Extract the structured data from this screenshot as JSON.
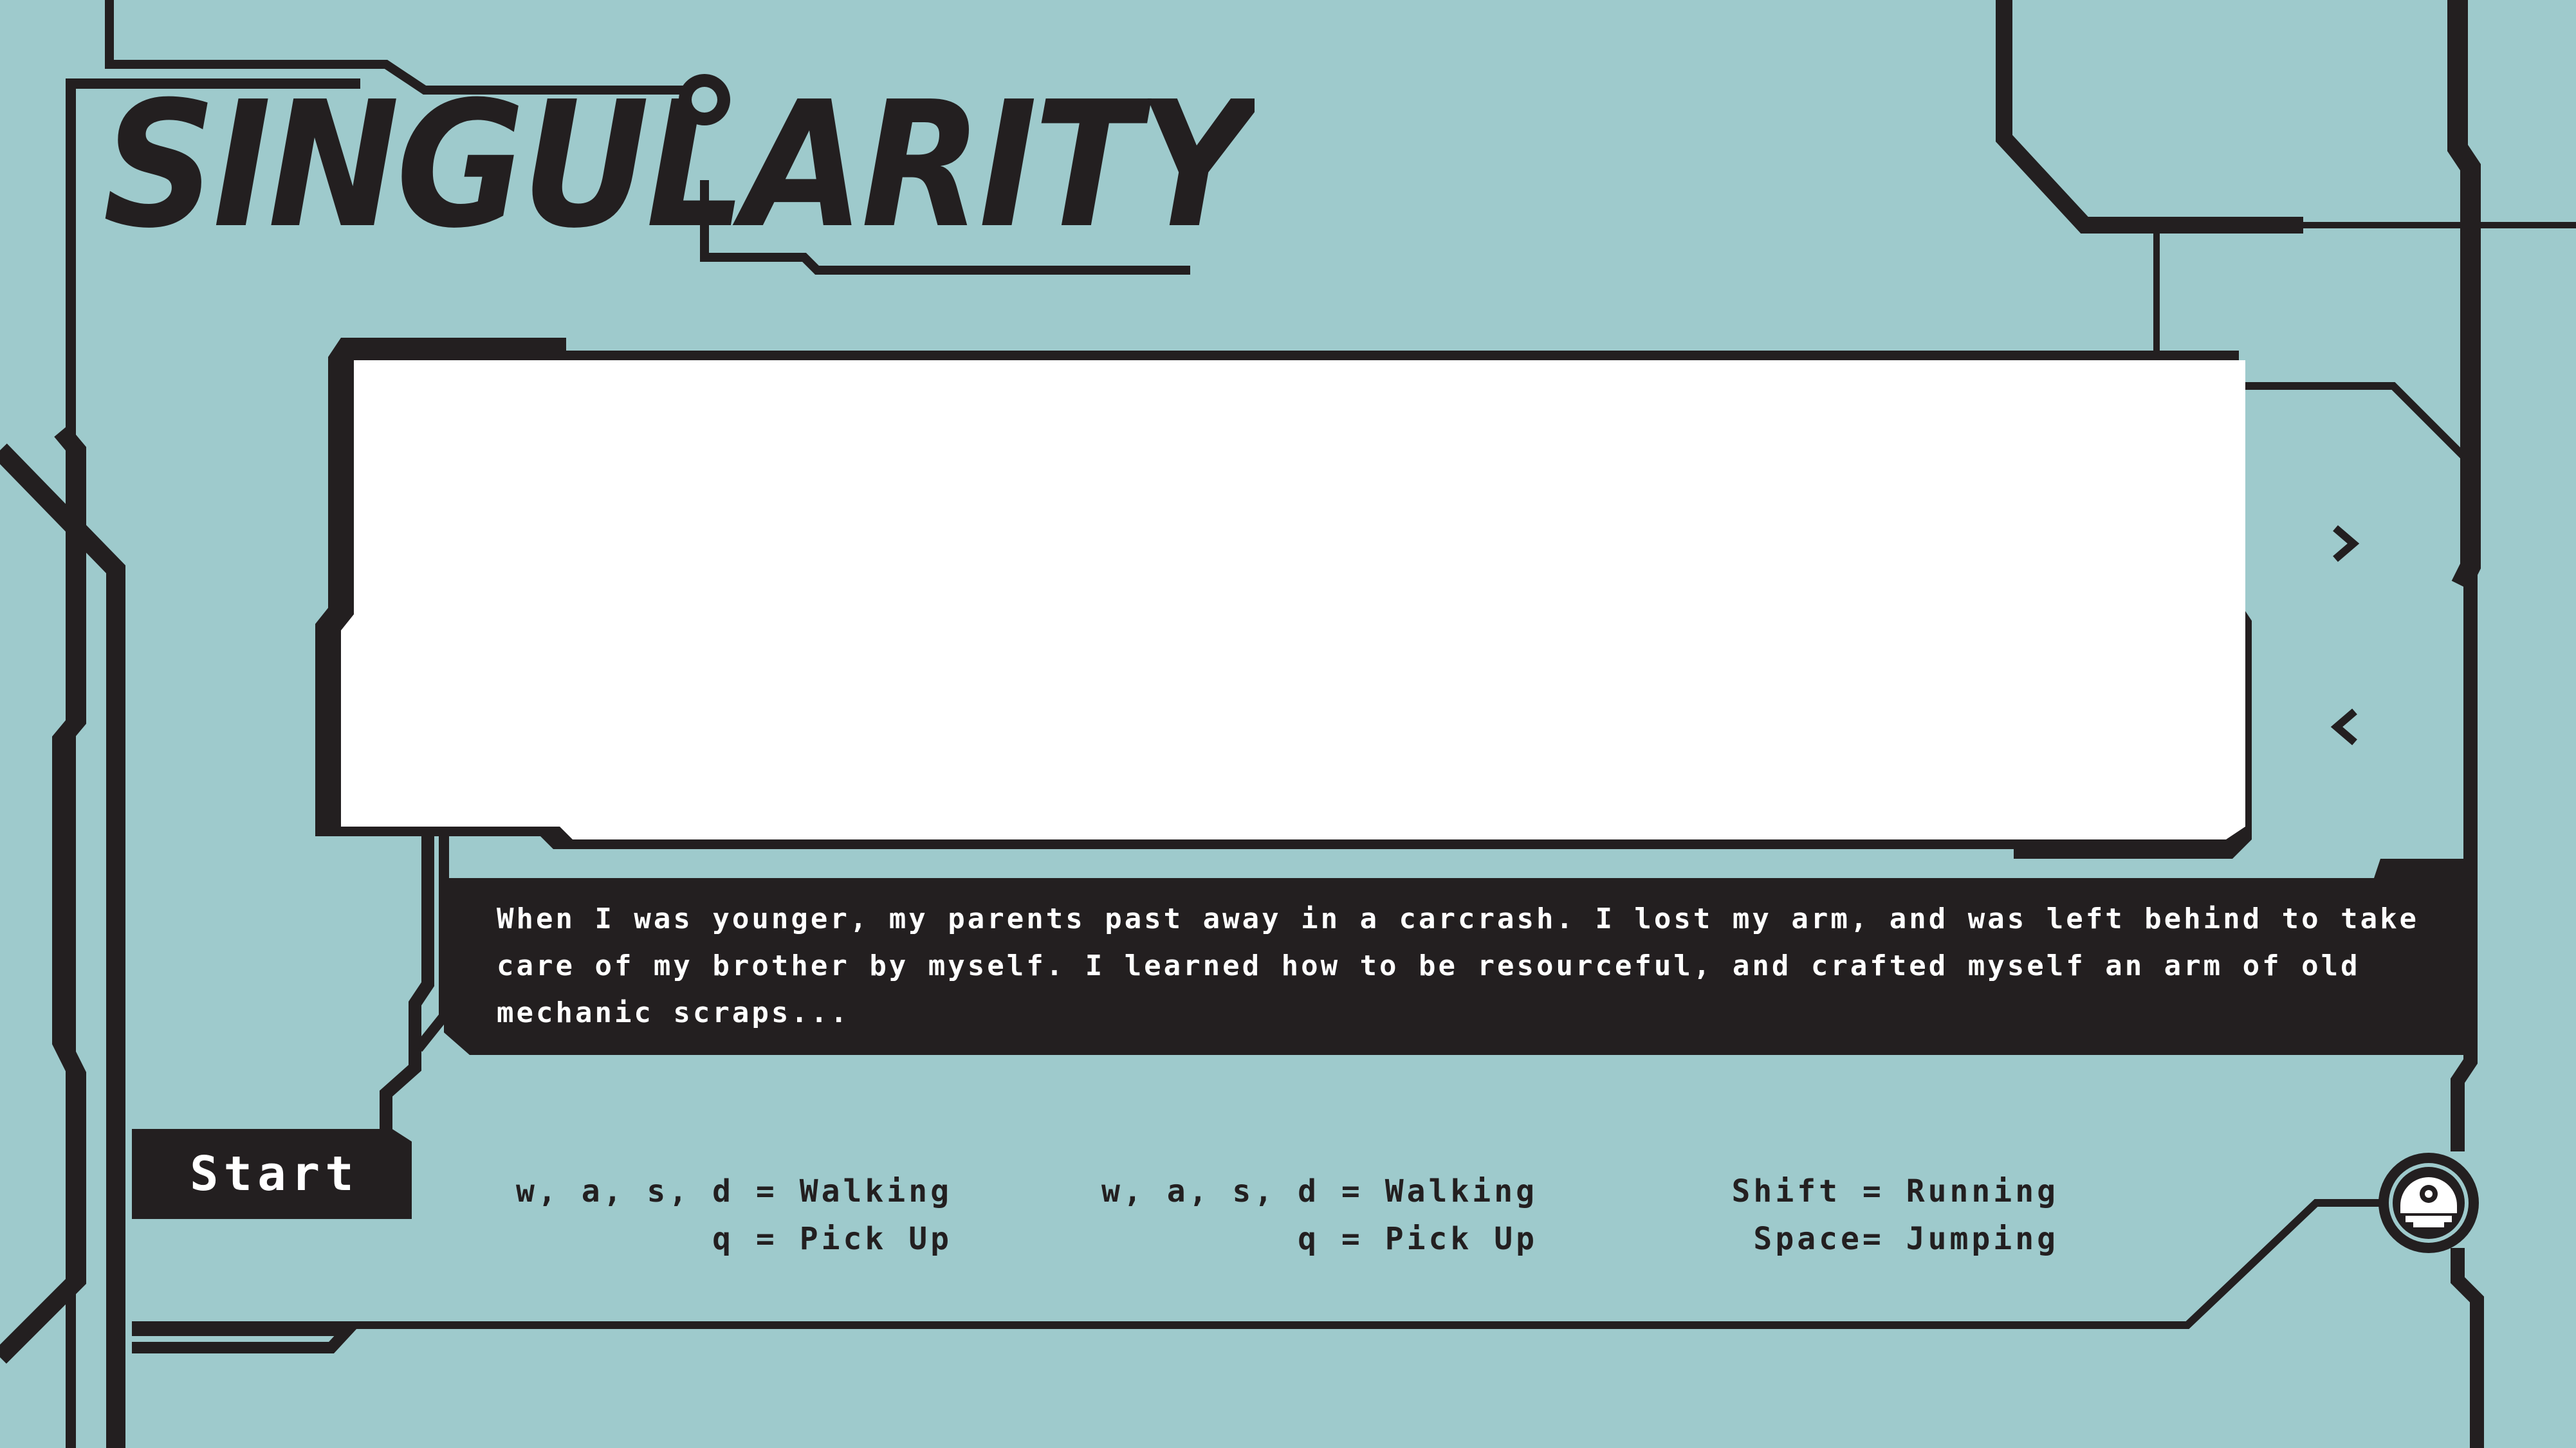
{
  "game": {
    "title": "SINGULARITY"
  },
  "story": {
    "text": "When I was younger, my parents past away in a carcrash. I lost my arm, and was left behind to take care of my brother by myself. I learned how to be resourceful, and crafted myself an arm of old mechanic scraps..."
  },
  "navigation": {
    "next_icon": "chevron-right-icon",
    "prev_icon": "chevron-left-icon"
  },
  "start_button": {
    "label": "Start"
  },
  "controls": [
    {
      "line1": "w, a, s, d = Walking",
      "line2": "q = Pick Up"
    },
    {
      "line1": "w, a, s, d = Walking",
      "line2": "q = Pick Up"
    },
    {
      "line1": "Shift = Running",
      "line2": "Space= Jumping"
    }
  ],
  "badge": {
    "icon": "robot-head-icon"
  },
  "colors": {
    "background": "#9ecacc",
    "ink": "#231f20",
    "panel": "#ffffff",
    "text_light": "#ffffff"
  }
}
